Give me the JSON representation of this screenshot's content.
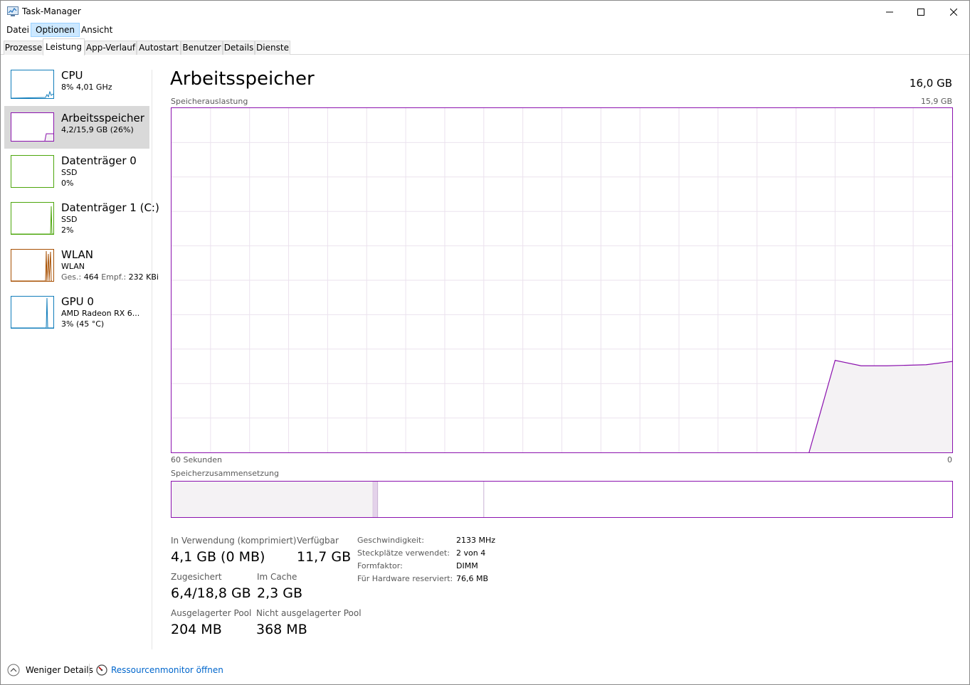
{
  "window": {
    "title": "Task-Manager",
    "icon": "task-manager-icon",
    "controls": [
      "minimize-icon",
      "maximize-icon",
      "close-icon"
    ]
  },
  "menu": {
    "items": [
      {
        "label": "Datei"
      },
      {
        "label": "Optionen"
      },
      {
        "label": "Ansicht"
      }
    ]
  },
  "tabs": [
    {
      "label": "Prozesse"
    },
    {
      "label": "Leistung"
    },
    {
      "label": "App-Verlauf"
    },
    {
      "label": "Autostart"
    },
    {
      "label": "Benutzer"
    },
    {
      "label": "Details"
    },
    {
      "label": "Dienste"
    }
  ],
  "sidebar": {
    "items": [
      {
        "title": "CPU",
        "line1": "8% 4,01 GHz",
        "line2": "",
        "color": "#117dbb"
      },
      {
        "title": "Arbeitsspeicher",
        "line1": "4,2/15,9 GB (26%)",
        "line2": "",
        "color": "#8b12ae"
      },
      {
        "title": "Datenträger 0",
        "line1": "SSD",
        "line2": "0%",
        "color": "#4da60c"
      },
      {
        "title": "Datenträger 1 (C:)",
        "line1": "SSD",
        "line2": "2%",
        "color": "#4da60c"
      },
      {
        "title": "WLAN",
        "line1": "WLAN",
        "line2_label_send": "Ges.:",
        "line2_send": "464",
        "line2_label_recv": "Empf.:",
        "line2_recv": "232 KBi",
        "color": "#a74f01"
      },
      {
        "title": "GPU 0",
        "line1": "AMD Radeon RX 6...",
        "line2": "3% (45 °C)",
        "color": "#117dbb"
      }
    ]
  },
  "main": {
    "title": "Arbeitsspeicher",
    "total": "16,0 GB",
    "usage_label": "Speicherauslastung",
    "usage_max": "15,9 GB",
    "time_left": "60 Sekunden",
    "time_right": "0",
    "composition_label": "Speicherzusammensetzung",
    "accent": "#8b12ae",
    "fill": "#f4f2f4"
  },
  "chart_data": {
    "type": "area",
    "ylim": [
      0,
      15.9
    ],
    "xlim": [
      60,
      0
    ],
    "x": [
      60,
      11,
      9,
      7,
      5,
      2,
      0
    ],
    "y": [
      0,
      0,
      4.25,
      4.0,
      4.0,
      4.05,
      4.2
    ],
    "ylabel": "Speicherauslastung",
    "xlabel": "60 Sekunden"
  },
  "composition": {
    "in_use_fraction": 0.258,
    "modified_fraction": 0.006,
    "standby_fraction": 0.136
  },
  "stats": {
    "in_use_label": "In Verwendung (komprimiert)",
    "in_use_value": "4,1 GB (0 MB)",
    "available_label": "Verfügbar",
    "available_value": "11,7 GB",
    "committed_label": "Zugesichert",
    "committed_value": "6,4/18,8 GB",
    "cached_label": "Im Cache",
    "cached_value": "2,3 GB",
    "paged_label": "Ausgelagerter Pool",
    "paged_value": "204 MB",
    "nonpaged_label": "Nicht ausgelagerter Pool",
    "nonpaged_value": "368 MB"
  },
  "details": [
    {
      "label": "Geschwindigkeit:",
      "value": "2133 MHz"
    },
    {
      "label": "Steckplätze verwendet:",
      "value": "2 von 4"
    },
    {
      "label": "Formfaktor:",
      "value": "DIMM"
    },
    {
      "label": "Für Hardware reserviert:",
      "value": "76,6 MB"
    }
  ],
  "footer": {
    "fewer_details": "Weniger Details",
    "resource_monitor": "Ressourcenmonitor öffnen"
  }
}
